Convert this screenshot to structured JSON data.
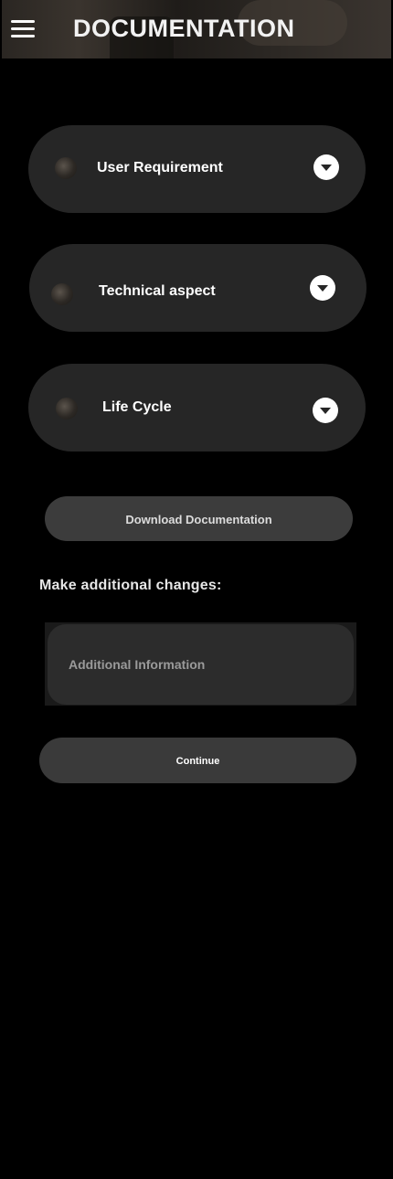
{
  "header": {
    "title": "DOCUMENTATION",
    "menu_icon": "hamburger-menu-icon"
  },
  "sections": [
    {
      "label": "User Requirement",
      "thumb_icon": "section-thumbnail-icon",
      "toggle_icon": "chevron-down-icon"
    },
    {
      "label": "Technical aspect",
      "thumb_icon": "section-thumbnail-icon",
      "toggle_icon": "chevron-down-icon"
    },
    {
      "label": "Life Cycle",
      "thumb_icon": "section-thumbnail-icon",
      "toggle_icon": "chevron-down-icon"
    }
  ],
  "download": {
    "label": "Download Documentation"
  },
  "changes": {
    "label": "Make additional changes:",
    "placeholder": "Additional Information",
    "value": ""
  },
  "continue": {
    "label": "Continue"
  },
  "colors": {
    "background": "#000000",
    "card": "#262626",
    "button": "#3c3c3c",
    "text": "#ffffff"
  }
}
